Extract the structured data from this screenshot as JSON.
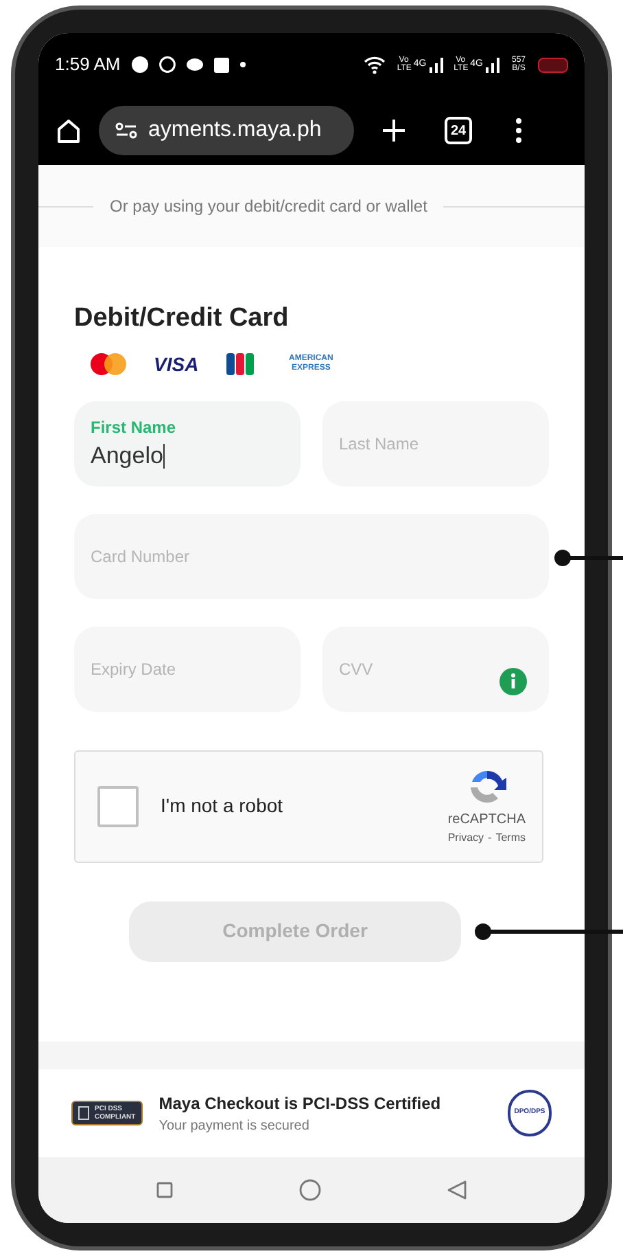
{
  "status_bar": {
    "time": "1:59 AM",
    "signals": [
      {
        "volte": "Vo LTE",
        "network": "4G"
      },
      {
        "volte": "Vo LTE",
        "network": "4G"
      }
    ],
    "speed": "557 B/S"
  },
  "browser": {
    "url": "ayments.maya.ph",
    "tab_count": "24"
  },
  "divider_text": "Or pay using your debit/credit card or wallet",
  "card_section": {
    "title": "Debit/Credit Card",
    "brands": [
      "VISA",
      "AMERICAN EXPRESS"
    ],
    "fields": [
      {
        "kind": "half",
        "label": "First Name",
        "value": "Angelo",
        "focused": true
      },
      {
        "kind": "half",
        "placeholder": "Last Name",
        "focused": false
      },
      {
        "kind": "full",
        "placeholder": "Card Number",
        "focused": false
      },
      {
        "kind": "half",
        "placeholder": "Expiry Date",
        "focused": false
      },
      {
        "kind": "half",
        "placeholder": "CVV",
        "focused": false,
        "info": true
      }
    ],
    "captcha": {
      "label": "I'm not a robot",
      "checked": false,
      "brand": "reCAPTCHA",
      "links": [
        "Privacy",
        "Terms"
      ],
      "link_separator": "-"
    },
    "button": {
      "label": "Complete Order",
      "disabled": true
    }
  },
  "footer": {
    "badge": [
      "PCI DSS",
      "COMPLIANT"
    ],
    "title": "Maya Checkout is PCI-DSS Certified",
    "subtitle": "Your payment is secured",
    "seal": "DPO/DPS"
  }
}
